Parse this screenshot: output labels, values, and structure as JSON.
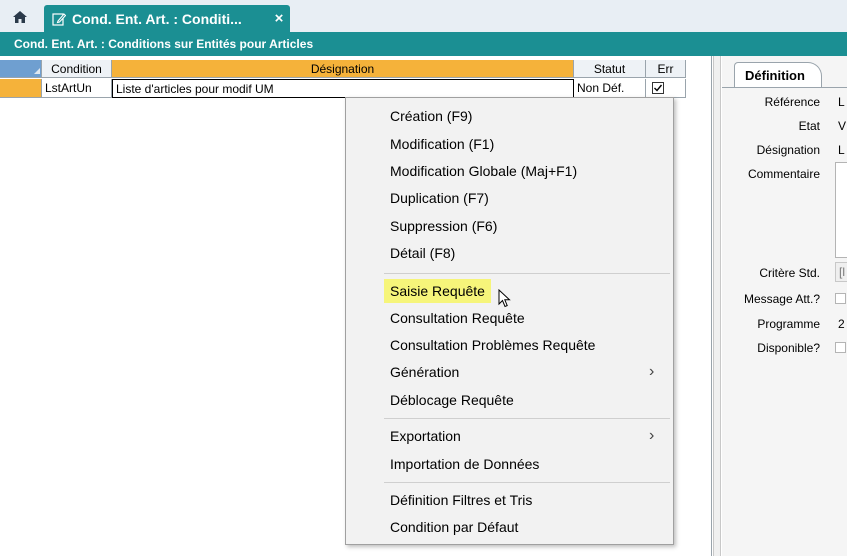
{
  "tabs": {
    "home_icon": "home-icon",
    "doc_tab": {
      "title": "Cond. Ent. Art. : Conditi...",
      "close": "×",
      "icon": "edit-icon"
    }
  },
  "window": {
    "title": "Cond. Ent. Art. : Conditions sur Entités pour Articles"
  },
  "grid": {
    "columns": [
      "Condition",
      "Désignation",
      "Statut",
      "Err"
    ],
    "rows": [
      {
        "condition": "LstArtUn",
        "designation": "Liste d'articles pour modif UM",
        "statut": "Non Déf.",
        "err": true
      }
    ]
  },
  "panel": {
    "tab": "Définition",
    "fields": {
      "reference_label": "Référence",
      "reference_value": "L",
      "etat_label": "Etat",
      "etat_value": "V",
      "designation_label": "Désignation",
      "designation_value": "L",
      "commentaire_label": "Commentaire",
      "critere_label": "Critère Std.",
      "critere_value": "[l",
      "message_label": "Message Att.?",
      "programme_label": "Programme",
      "programme_value": "2",
      "disponible_label": "Disponible?"
    }
  },
  "menu": {
    "items": [
      {
        "label": "Création (F9)"
      },
      {
        "label": "Modification (F1)"
      },
      {
        "label": "Modification Globale (Maj+F1)"
      },
      {
        "label": "Duplication (F7)"
      },
      {
        "label": "Suppression (F6)"
      },
      {
        "label": "Détail (F8)"
      },
      {
        "label": "Saisie Requête",
        "highlighted": true
      },
      {
        "label": "Consultation Requête"
      },
      {
        "label": "Consultation Problèmes Requête"
      },
      {
        "label": "Génération",
        "submenu": true
      },
      {
        "label": "Déblocage Requête"
      },
      {
        "label": "Exportation",
        "submenu": true
      },
      {
        "label": "Importation de Données"
      },
      {
        "label": "Définition Filtres et Tris"
      },
      {
        "label": "Condition par Défaut"
      }
    ]
  },
  "colors": {
    "teal": "#1b8f93",
    "row_selected": "#f5b23a",
    "menu_highlight": "#f6f57a"
  }
}
